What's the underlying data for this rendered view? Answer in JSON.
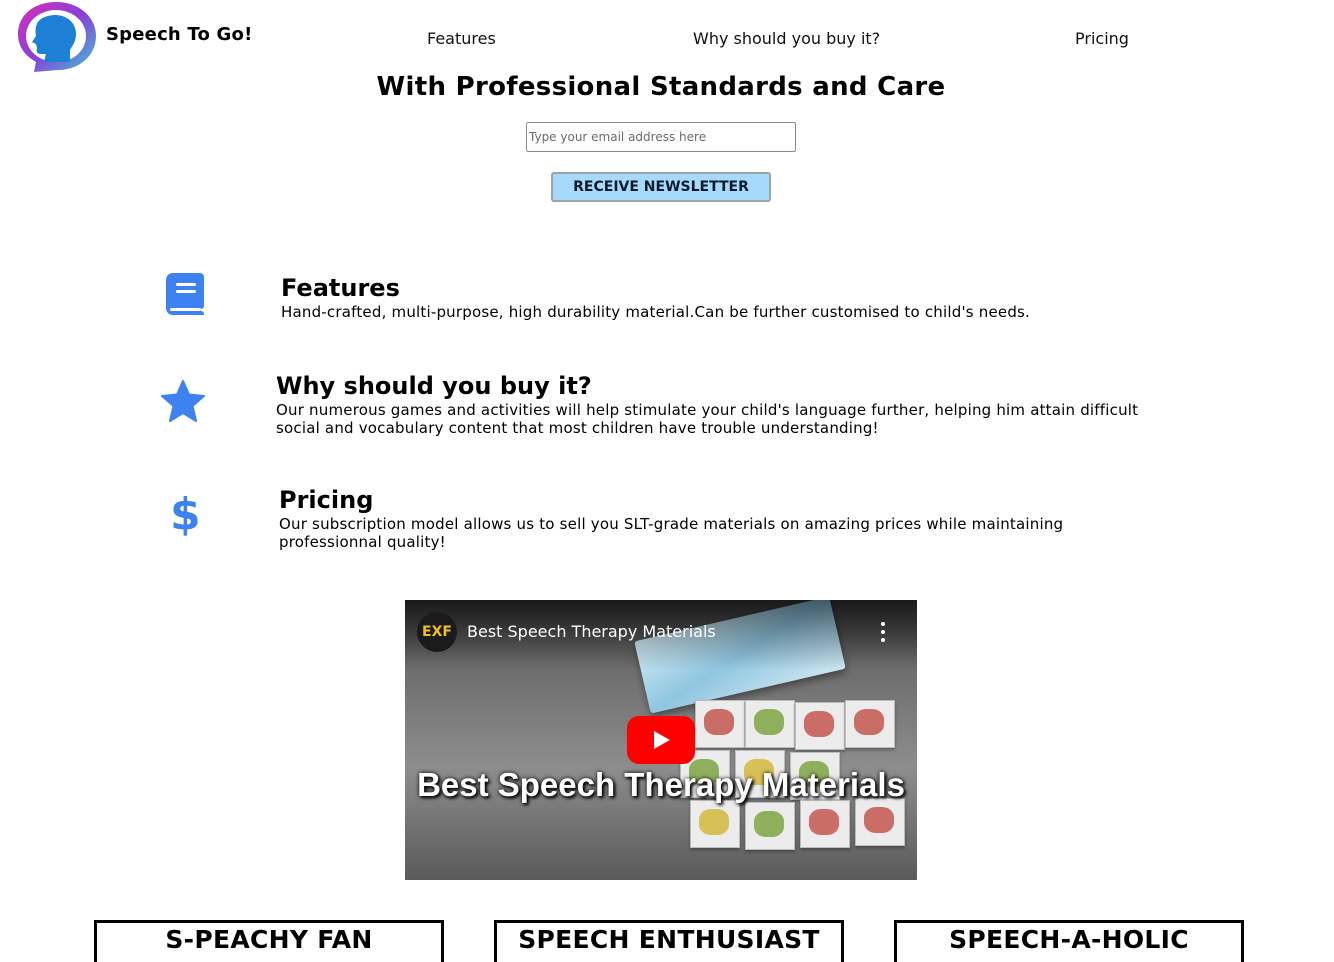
{
  "brand": {
    "name": "Speech To Go!",
    "logo_icon": "head-silhouette-icon"
  },
  "nav": {
    "features": "Features",
    "why": "Why should you buy it?",
    "pricing": "Pricing"
  },
  "hero": {
    "title": "With Professional Standards and Care",
    "email_placeholder": "Type your email address here",
    "button_label": "Receive Newsletter"
  },
  "features": [
    {
      "icon": "book-icon",
      "title": "Features",
      "text": "Hand-crafted, multi-purpose, high durability material.Can be further customised to child's needs."
    },
    {
      "icon": "star-icon",
      "title": "Why should you buy it?",
      "text": "Our numerous games and activities will help stimulate your child's language further, helping him attain difficult social and vocabulary content that most children have trouble understanding!"
    },
    {
      "icon": "dollar-icon",
      "title": "Pricing",
      "text": "Our subscription model allows us to sell you SLT-grade materials on amazing prices while maintaining professionnal quality!"
    }
  ],
  "video": {
    "channel": "EXF",
    "title": "Best Speech Therapy Materials",
    "overlay_title": "Best Speech Therapy Materials"
  },
  "plans": [
    "S-PEACHY FAN",
    "SPEECH ENTHUSIAST",
    "SPEECH-A-HOLIC"
  ],
  "colors": {
    "icon_blue": "#3d82f0",
    "button_bg": "#a6dafc",
    "play_red": "#ff0000"
  }
}
